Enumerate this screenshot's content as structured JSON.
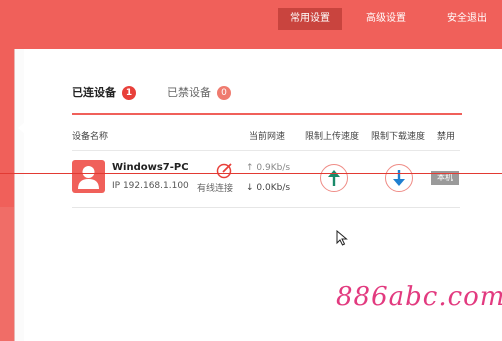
{
  "topnav": {
    "common": "常用设置",
    "advanced": "高级设置",
    "security_exit": "安全退出"
  },
  "tabs": {
    "connected_label": "已连设备",
    "connected_count": "1",
    "blocked_label": "已禁设备",
    "blocked_count": "0"
  },
  "table": {
    "headers": {
      "name": "设备名称",
      "current_speed": "当前网速",
      "upload_limit": "限制上传速度",
      "download_limit": "限制下载速度",
      "ban": "禁用"
    },
    "rows": [
      {
        "name": "Windows7-PC",
        "ip": "IP 192.168.1.100",
        "connection": "有线连接",
        "up_speed": "↑ 0.9Kb/s",
        "down_speed": "↓ 0.0Kb/s",
        "tag": "本机"
      }
    ]
  },
  "watermark": "886abc.com",
  "colors": {
    "brand_red": "#f0605a",
    "active_nav": "#c9443e",
    "up_arrow": "#1a8a6a",
    "down_arrow": "#1f7fd0"
  }
}
